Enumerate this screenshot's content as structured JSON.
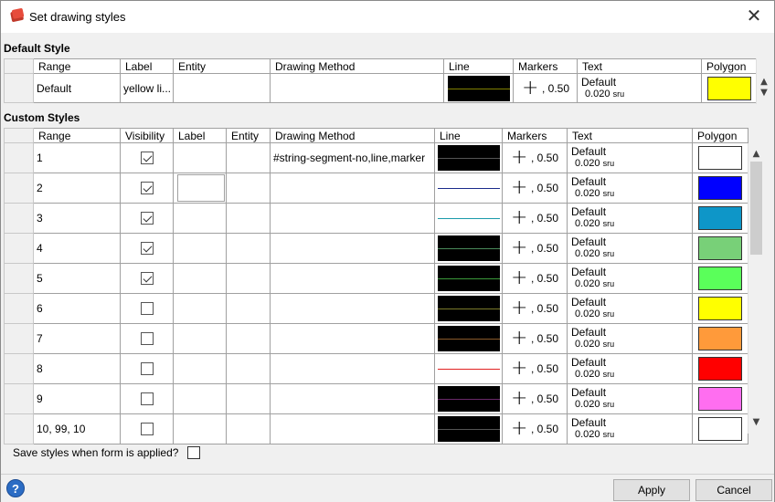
{
  "window": {
    "title": "Set drawing styles",
    "close_glyph": "✕"
  },
  "default_section": {
    "title": "Default Style",
    "columns": [
      "Range",
      "Label",
      "Entity",
      "Drawing Method",
      "Line",
      "Markers",
      "Text",
      "Polygon"
    ],
    "row": {
      "range": "Default",
      "label": "yellow li...",
      "entity": "",
      "method": "",
      "line_color": "#808000",
      "marker_icon": "plus-icon",
      "marker_value": ", 0.50",
      "text_font": "Default",
      "text_size": "0.020",
      "text_unit": "sru",
      "polygon_color": "#ffff00"
    }
  },
  "custom_section": {
    "title": "Custom Styles",
    "columns": [
      "Range",
      "Visibility",
      "Label",
      "Entity",
      "Drawing Method",
      "Line",
      "Markers",
      "Text",
      "Polygon"
    ],
    "rows": [
      {
        "range": "1",
        "visible": true,
        "label": "",
        "entity": "",
        "method": "#string-segment-no,line,marker",
        "line_bg": "dark",
        "line_color": "#555555",
        "marker_value": ", 0.50",
        "text_font": "Default",
        "text_size": "0.020",
        "text_unit": "sru",
        "polygon_color": "#ffffff"
      },
      {
        "range": "2",
        "visible": true,
        "label": "",
        "entity": "",
        "method": "",
        "line_bg": "light",
        "line_color": "#1a2a8a",
        "marker_value": ", 0.50",
        "text_font": "Default",
        "text_size": "0.020",
        "text_unit": "sru",
        "polygon_color": "#0000ff"
      },
      {
        "range": "3",
        "visible": true,
        "label": "",
        "entity": "",
        "method": "",
        "line_bg": "light",
        "line_color": "#1a9aaa",
        "marker_value": ", 0.50",
        "text_font": "Default",
        "text_size": "0.020",
        "text_unit": "sru",
        "polygon_color": "#0e96c8"
      },
      {
        "range": "4",
        "visible": true,
        "label": "",
        "entity": "",
        "method": "",
        "line_bg": "dark",
        "line_color": "#4a8a5a",
        "marker_value": ", 0.50",
        "text_font": "Default",
        "text_size": "0.020",
        "text_unit": "sru",
        "polygon_color": "#78d078"
      },
      {
        "range": "5",
        "visible": true,
        "label": "",
        "entity": "",
        "method": "",
        "line_bg": "dark",
        "line_color": "#3a9a3a",
        "marker_value": ", 0.50",
        "text_font": "Default",
        "text_size": "0.020",
        "text_unit": "sru",
        "polygon_color": "#5aff5a"
      },
      {
        "range": "6",
        "visible": false,
        "label": "",
        "entity": "",
        "method": "",
        "line_bg": "dark",
        "line_color": "#7a7a2a",
        "marker_value": ", 0.50",
        "text_font": "Default",
        "text_size": "0.020",
        "text_unit": "sru",
        "polygon_color": "#ffff00"
      },
      {
        "range": "7",
        "visible": false,
        "label": "",
        "entity": "",
        "method": "",
        "line_bg": "dark",
        "line_color": "#8a5a2a",
        "marker_value": ", 0.50",
        "text_font": "Default",
        "text_size": "0.020",
        "text_unit": "sru",
        "polygon_color": "#ff9a3a"
      },
      {
        "range": "8",
        "visible": false,
        "label": "",
        "entity": "",
        "method": "",
        "line_bg": "light",
        "line_color": "#e02020",
        "marker_value": ", 0.50",
        "text_font": "Default",
        "text_size": "0.020",
        "text_unit": "sru",
        "polygon_color": "#ff0000"
      },
      {
        "range": "9",
        "visible": false,
        "label": "",
        "entity": "",
        "method": "",
        "line_bg": "dark",
        "line_color": "#6a2a6a",
        "marker_value": ", 0.50",
        "text_font": "Default",
        "text_size": "0.020",
        "text_unit": "sru",
        "polygon_color": "#ff6ef0"
      },
      {
        "range": "10, 99, 10",
        "visible": false,
        "label": "",
        "entity": "",
        "method": "",
        "line_bg": "dark",
        "line_color": "#555555",
        "marker_value": ", 0.50",
        "text_font": "Default",
        "text_size": "0.020",
        "text_unit": "sru",
        "polygon_color": "#ffffff"
      }
    ]
  },
  "save_label": "Save styles when form is applied?",
  "save_checked": false,
  "help_glyph": "?",
  "buttons": {
    "apply": "Apply",
    "cancel": "Cancel"
  }
}
